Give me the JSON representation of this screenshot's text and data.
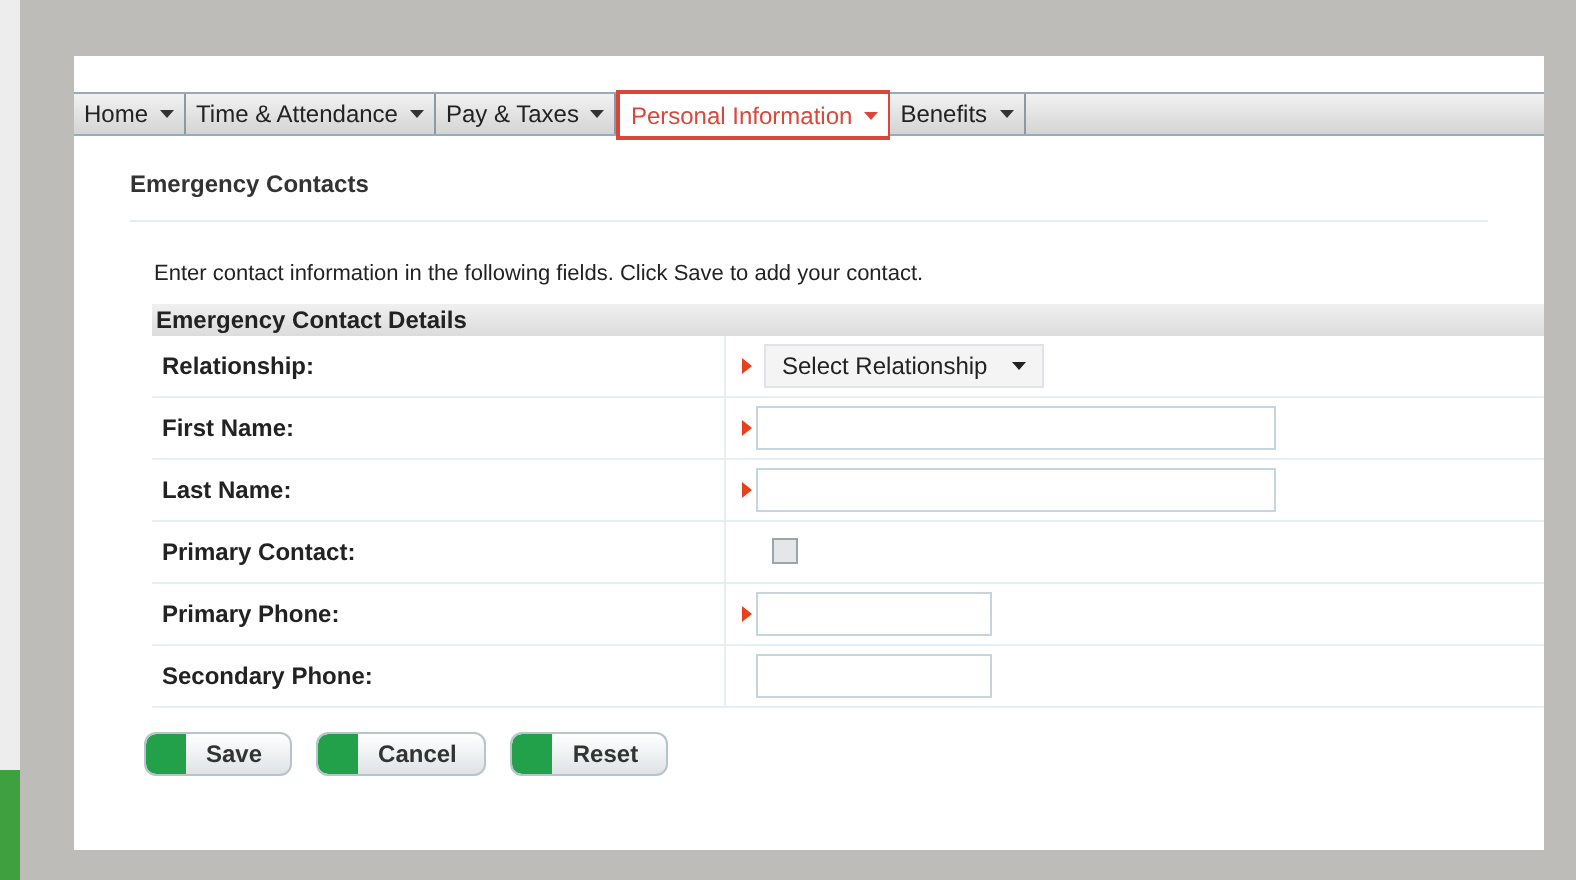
{
  "tabs": [
    {
      "label": "Home",
      "selected": false
    },
    {
      "label": "Time & Attendance",
      "selected": false
    },
    {
      "label": "Pay & Taxes",
      "selected": false
    },
    {
      "label": "Personal Information",
      "selected": true
    },
    {
      "label": "Benefits",
      "selected": false
    }
  ],
  "page_title": "Emergency Contacts",
  "instructions": "Enter contact information in the following fields. Click Save to add your contact.",
  "section_title": "Emergency Contact Details",
  "fields": [
    {
      "label": "Relationship:",
      "kind": "select",
      "required": true,
      "value": "Select Relationship"
    },
    {
      "label": "First Name:",
      "kind": "text",
      "required": true
    },
    {
      "label": "Last Name:",
      "kind": "text",
      "required": true
    },
    {
      "label": "Primary Contact:",
      "kind": "checkbox",
      "required": false,
      "checked": false
    },
    {
      "label": "Primary Phone:",
      "kind": "short_text",
      "required": true
    },
    {
      "label": "Secondary Phone:",
      "kind": "short_text",
      "required": false
    }
  ],
  "buttons": [
    "Save",
    "Cancel",
    "Reset"
  ]
}
